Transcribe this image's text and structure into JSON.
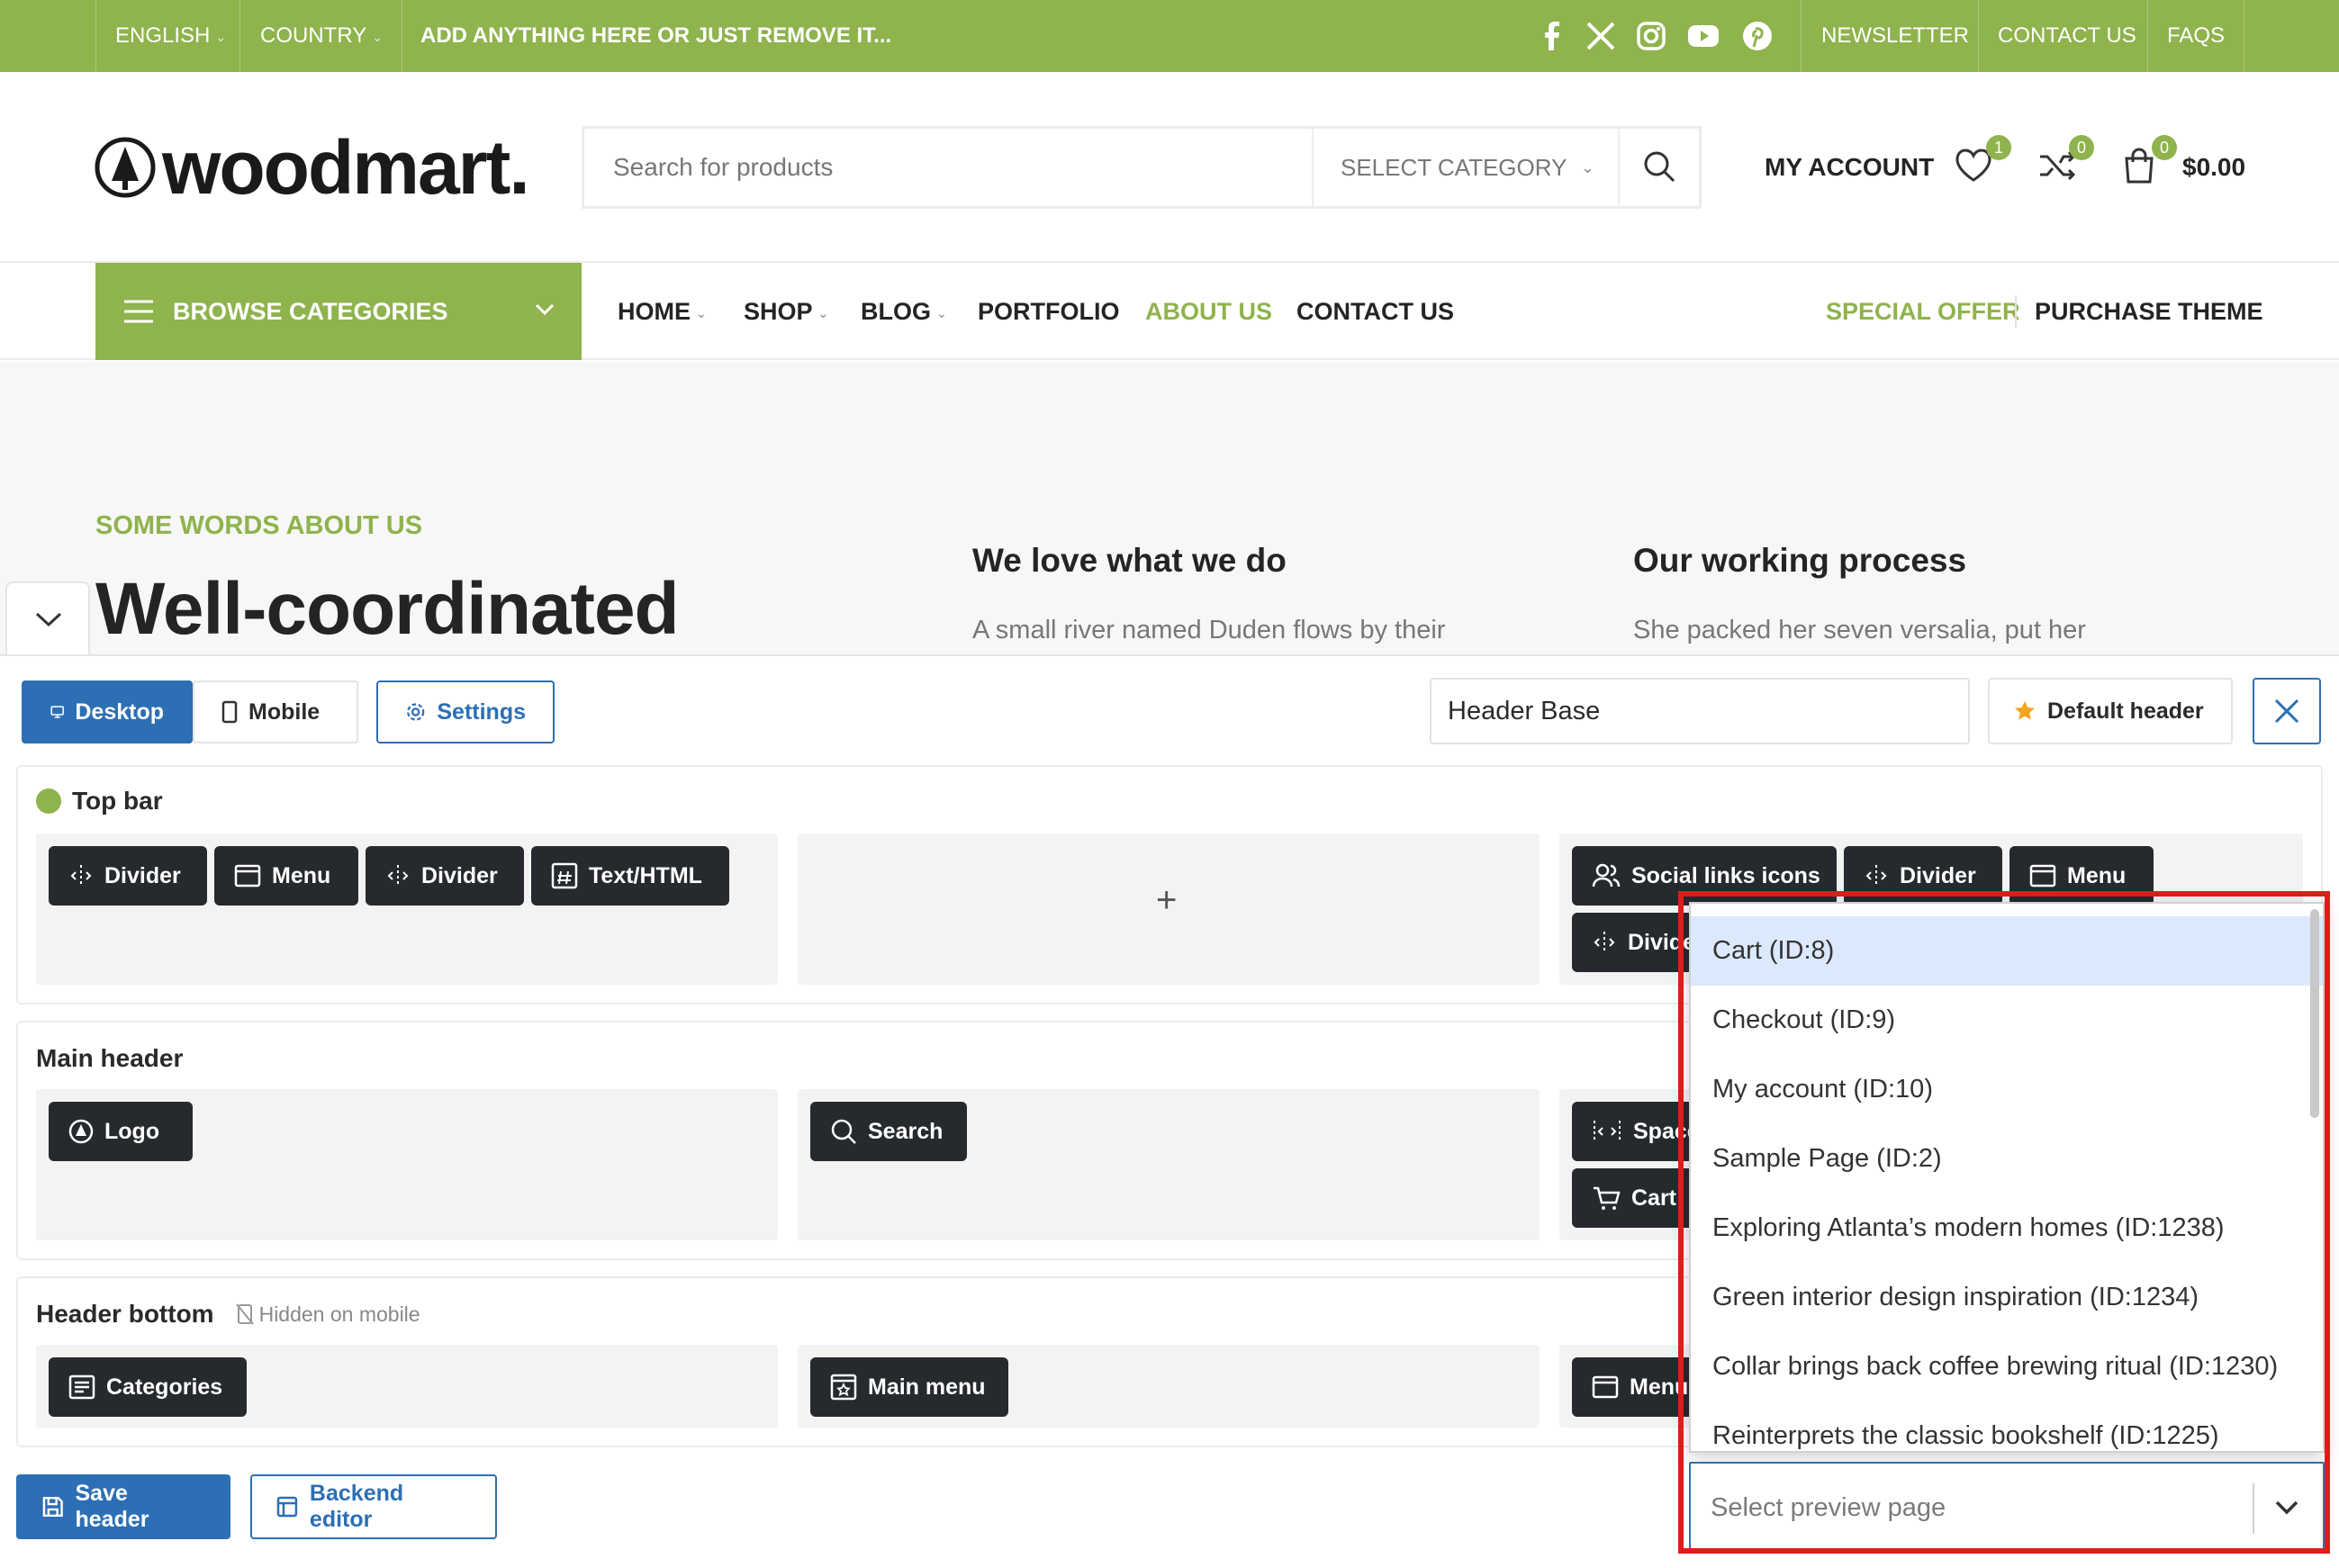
{
  "topbar": {
    "language": "ENGLISH",
    "country": "COUNTRY",
    "promo": "ADD ANYTHING HERE OR JUST REMOVE IT...",
    "social_icons": [
      "facebook-icon",
      "x-icon",
      "instagram-icon",
      "youtube-icon",
      "pinterest-icon"
    ],
    "links": [
      "NEWSLETTER",
      "CONTACT US",
      "FAQS"
    ]
  },
  "header": {
    "logo_text": "woodmart.",
    "search_placeholder": "Search for products",
    "search_category": "SELECT CATEGORY",
    "account": "MY ACCOUNT",
    "wishlist_count": "1",
    "compare_count": "0",
    "cart_count": "0",
    "cart_total": "$0.00"
  },
  "nav": {
    "browse": "BROWSE CATEGORIES",
    "items": [
      "HOME",
      "SHOP",
      "BLOG",
      "PORTFOLIO",
      "ABOUT US",
      "CONTACT US"
    ],
    "active_item": "ABOUT US",
    "special_offer": "SPECIAL OFFER",
    "purchase": "PURCHASE THEME"
  },
  "hero": {
    "subtitle": "SOME WORDS ABOUT US",
    "title": "Well-coordinated",
    "col1_title": "We love what we do",
    "col1_text": "A small river named Duden flows by their",
    "col2_title": "Our working process",
    "col2_text": "She packed her seven versalia, put her"
  },
  "builder": {
    "desktop": "Desktop",
    "mobile": "Mobile",
    "settings": "Settings",
    "header_name": "Header Base",
    "default_header": "Default header",
    "rows": {
      "top_bar": {
        "title": "Top bar",
        "left": [
          "Divider",
          "Menu",
          "Divider",
          "Text/HTML"
        ],
        "right": [
          "Social links icons",
          "Divider",
          "Menu",
          "Divider"
        ]
      },
      "main_header": {
        "title": "Main header",
        "left": [
          "Logo"
        ],
        "center": [
          "Search"
        ],
        "right": [
          "Space",
          "Cart"
        ]
      },
      "header_bottom": {
        "title": "Header bottom",
        "note": "Hidden on mobile",
        "left": [
          "Categories"
        ],
        "center": [
          "Main menu"
        ],
        "right": [
          "Menu"
        ]
      }
    },
    "save_header": "Save header",
    "backend_editor": "Backend editor",
    "preview_placeholder": "Select preview page",
    "preview_options": [
      "Cart (ID:8)",
      "Checkout (ID:9)",
      "My account (ID:10)",
      "Sample Page (ID:2)",
      "Exploring Atlanta’s modern homes (ID:1238)",
      "Green interior design inspiration (ID:1234)",
      "Collar brings back coffee brewing ritual (ID:1230)",
      "Reinterprets the classic bookshelf (ID:1225)"
    ]
  },
  "colors": {
    "brand_green": "#8fb34d",
    "builder_blue": "#2d6fb4",
    "element_dark": "#26292d",
    "highlight_red": "#e01b1b"
  }
}
